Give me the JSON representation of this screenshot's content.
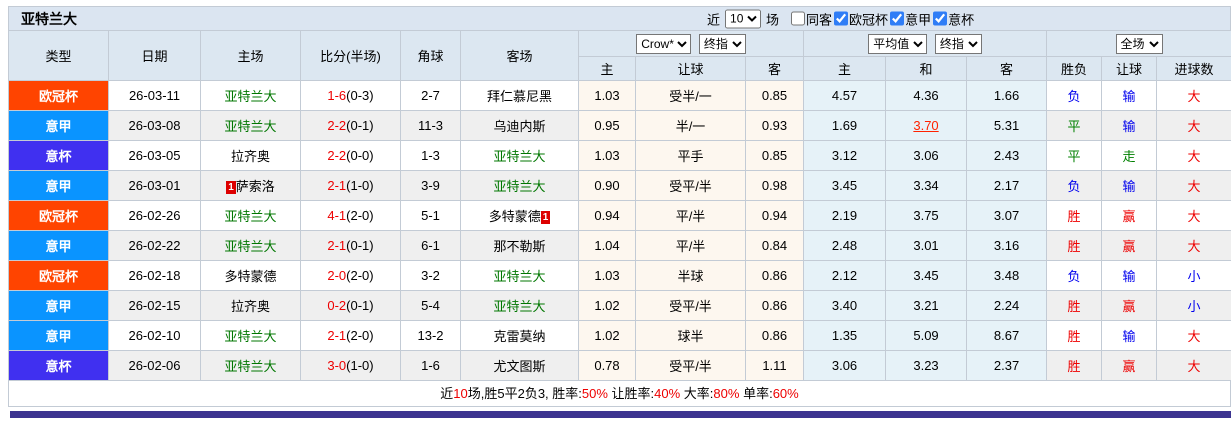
{
  "header": {
    "team": "亚特兰大",
    "recent": {
      "prefix": "近",
      "suffix": "场",
      "value": "10"
    },
    "filters": [
      {
        "label": "同客",
        "checked": false
      },
      {
        "label": "欧冠杯",
        "checked": true
      },
      {
        "label": "意甲",
        "checked": true
      },
      {
        "label": "意杯",
        "checked": true
      }
    ]
  },
  "table": {
    "columns": {
      "type": "类型",
      "date": "日期",
      "home": "主场",
      "score": "比分(半场)",
      "corner": "角球",
      "away": "客场",
      "asia_home": "主",
      "asia_handicap": "让球",
      "asia_away": "客",
      "euro_home": "主",
      "euro_draw": "和",
      "euro_away": "客",
      "result_wdl": "胜负",
      "result_handicap": "让球",
      "result_goals": "进球数"
    },
    "selects": {
      "asia_primary": "Crow*",
      "asia_secondary": "终指",
      "europe_primary": "平均值",
      "europe_secondary": "终指",
      "result_scope": "全场"
    },
    "league_colors": {
      "欧冠杯": "#ff4400",
      "意甲": "#0a94ff",
      "意杯": "#4030f0"
    },
    "rows": [
      {
        "league": "欧冠杯",
        "date": "26-03-11",
        "home": {
          "name": "亚特兰大",
          "green": true
        },
        "score": {
          "ft": "1-6",
          "ht": "(0-3)"
        },
        "corner": "2-7",
        "away": {
          "name": "拜仁慕尼黑",
          "green": false
        },
        "asia": [
          "1.03",
          "受半/一",
          "0.85"
        ],
        "europe": [
          "4.57",
          "4.36",
          "1.66"
        ],
        "europe_hl": null,
        "results": [
          [
            "负",
            "blue"
          ],
          [
            "输",
            "blue"
          ],
          [
            "大",
            "red"
          ]
        ]
      },
      {
        "league": "意甲",
        "date": "26-03-08",
        "home": {
          "name": "亚特兰大",
          "green": true
        },
        "score": {
          "ft": "2-2",
          "ht": "(0-1)"
        },
        "corner": "11-3",
        "away": {
          "name": "乌迪内斯",
          "green": false
        },
        "asia": [
          "0.95",
          "半/一",
          "0.93"
        ],
        "europe": [
          "1.69",
          "3.70",
          "5.31"
        ],
        "europe_hl": 1,
        "results": [
          [
            "平",
            "green"
          ],
          [
            "输",
            "blue"
          ],
          [
            "大",
            "red"
          ]
        ]
      },
      {
        "league": "意杯",
        "date": "26-03-05",
        "home": {
          "name": "拉齐奥",
          "green": false
        },
        "score": {
          "ft": "2-2",
          "ht": "(0-0)"
        },
        "corner": "1-3",
        "away": {
          "name": "亚特兰大",
          "green": true
        },
        "asia": [
          "1.03",
          "平手",
          "0.85"
        ],
        "europe": [
          "3.12",
          "3.06",
          "2.43"
        ],
        "europe_hl": null,
        "results": [
          [
            "平",
            "green"
          ],
          [
            "走",
            "green"
          ],
          [
            "大",
            "red"
          ]
        ]
      },
      {
        "league": "意甲",
        "date": "26-03-01",
        "home": {
          "name": "萨索洛",
          "green": false,
          "badge": {
            "text": "1",
            "position": "before"
          }
        },
        "score": {
          "ft": "2-1",
          "ht": "(1-0)"
        },
        "corner": "3-9",
        "away": {
          "name": "亚特兰大",
          "green": true
        },
        "asia": [
          "0.90",
          "受平/半",
          "0.98"
        ],
        "europe": [
          "3.45",
          "3.34",
          "2.17"
        ],
        "europe_hl": null,
        "results": [
          [
            "负",
            "blue"
          ],
          [
            "输",
            "blue"
          ],
          [
            "大",
            "red"
          ]
        ]
      },
      {
        "league": "欧冠杯",
        "date": "26-02-26",
        "home": {
          "name": "亚特兰大",
          "green": true
        },
        "score": {
          "ft": "4-1",
          "ht": "(2-0)"
        },
        "corner": "5-1",
        "away": {
          "name": "多特蒙德",
          "green": false,
          "badge": {
            "text": "1",
            "position": "after"
          }
        },
        "asia": [
          "0.94",
          "平/半",
          "0.94"
        ],
        "europe": [
          "2.19",
          "3.75",
          "3.07"
        ],
        "europe_hl": null,
        "results": [
          [
            "胜",
            "red"
          ],
          [
            "赢",
            "red"
          ],
          [
            "大",
            "red"
          ]
        ]
      },
      {
        "league": "意甲",
        "date": "26-02-22",
        "home": {
          "name": "亚特兰大",
          "green": true
        },
        "score": {
          "ft": "2-1",
          "ht": "(0-1)"
        },
        "corner": "6-1",
        "away": {
          "name": "那不勒斯",
          "green": false
        },
        "asia": [
          "1.04",
          "平/半",
          "0.84"
        ],
        "europe": [
          "2.48",
          "3.01",
          "3.16"
        ],
        "europe_hl": null,
        "results": [
          [
            "胜",
            "red"
          ],
          [
            "赢",
            "red"
          ],
          [
            "大",
            "red"
          ]
        ]
      },
      {
        "league": "欧冠杯",
        "date": "26-02-18",
        "home": {
          "name": "多特蒙德",
          "green": false
        },
        "score": {
          "ft": "2-0",
          "ht": "(2-0)"
        },
        "corner": "3-2",
        "away": {
          "name": "亚特兰大",
          "green": true
        },
        "asia": [
          "1.03",
          "半球",
          "0.86"
        ],
        "europe": [
          "2.12",
          "3.45",
          "3.48"
        ],
        "europe_hl": null,
        "results": [
          [
            "负",
            "blue"
          ],
          [
            "输",
            "blue"
          ],
          [
            "小",
            "blue"
          ]
        ]
      },
      {
        "league": "意甲",
        "date": "26-02-15",
        "home": {
          "name": "拉齐奥",
          "green": false
        },
        "score": {
          "ft": "0-2",
          "ht": "(0-1)"
        },
        "corner": "5-4",
        "away": {
          "name": "亚特兰大",
          "green": true
        },
        "asia": [
          "1.02",
          "受平/半",
          "0.86"
        ],
        "europe": [
          "3.40",
          "3.21",
          "2.24"
        ],
        "europe_hl": null,
        "results": [
          [
            "胜",
            "red"
          ],
          [
            "赢",
            "red"
          ],
          [
            "小",
            "blue"
          ]
        ]
      },
      {
        "league": "意甲",
        "date": "26-02-10",
        "home": {
          "name": "亚特兰大",
          "green": true
        },
        "score": {
          "ft": "2-1",
          "ht": "(2-0)"
        },
        "corner": "13-2",
        "away": {
          "name": "克雷莫纳",
          "green": false
        },
        "asia": [
          "1.02",
          "球半",
          "0.86"
        ],
        "europe": [
          "1.35",
          "5.09",
          "8.67"
        ],
        "europe_hl": null,
        "results": [
          [
            "胜",
            "red"
          ],
          [
            "输",
            "blue"
          ],
          [
            "大",
            "red"
          ]
        ]
      },
      {
        "league": "意杯",
        "date": "26-02-06",
        "home": {
          "name": "亚特兰大",
          "green": true
        },
        "score": {
          "ft": "3-0",
          "ht": "(1-0)"
        },
        "corner": "1-6",
        "away": {
          "name": "尤文图斯",
          "green": false
        },
        "asia": [
          "0.78",
          "受平/半",
          "1.11"
        ],
        "europe": [
          "3.06",
          "3.23",
          "2.37"
        ],
        "europe_hl": null,
        "results": [
          [
            "胜",
            "red"
          ],
          [
            "赢",
            "red"
          ],
          [
            "大",
            "red"
          ]
        ]
      }
    ]
  },
  "footer": {
    "segments": [
      [
        "近",
        "k"
      ],
      [
        "10",
        "r"
      ],
      [
        "场,胜5平2负3, 胜率:",
        "k"
      ],
      [
        "50%",
        "r"
      ],
      [
        " 让胜率:",
        "k"
      ],
      [
        "40%",
        "r"
      ],
      [
        " 大率:",
        "k"
      ],
      [
        "80%",
        "r"
      ],
      [
        " 单率:",
        "k"
      ],
      [
        "60%",
        "r"
      ]
    ]
  },
  "colors": {
    "accent_checkbox": "#2f7df6",
    "header_bg": "#dce7f1",
    "asia_col_bg": "#fdf7ef",
    "euro_col_bg": "#e6f2f8",
    "row_alt_bg": "#efefef",
    "bottom_bar": "#3c3490",
    "win_red": "#ee0000",
    "lose_blue": "#0000ee",
    "draw_green": "#008000"
  }
}
